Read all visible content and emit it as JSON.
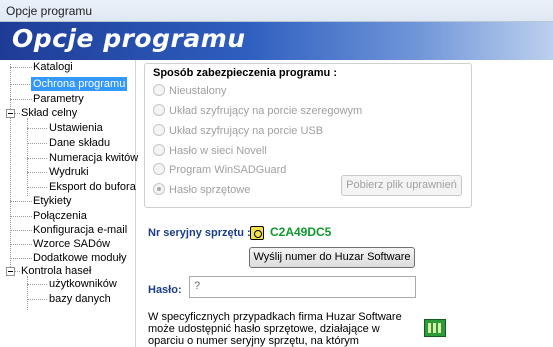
{
  "window": {
    "title": "Opcje programu"
  },
  "banner": {
    "title": "Opcje programu"
  },
  "tree": {
    "items": [
      "Katalogi",
      "Ochrona programu",
      "Parametry",
      "Skład celny",
      "Ustawienia",
      "Dane składu",
      "Numeracja kwitów",
      "Wydruki",
      "Eksport do bufora",
      "Etykiety",
      "Połączenia",
      "Konfiguracja e-mail",
      "Wzorce SADów",
      "Dodatkowe moduły",
      "Kontrola haseł",
      "użytkowników",
      "bazy danych"
    ],
    "selected": "Ochrona programu"
  },
  "protection": {
    "title": "Sposób zabezpieczenia programu :",
    "options": [
      "Nieustalony",
      "Układ szyfrujący na porcie szeregowym",
      "Układ szyfrujący na porcie USB",
      "Hasło w sieci Novell",
      "Program WinSADGuard",
      "Hasło sprzętowe"
    ],
    "selected": "Hasło sprzętowe",
    "download_button": "Pobierz plik uprawnień"
  },
  "serial": {
    "label": "Nr seryjny sprzętu :",
    "value": "C2A49DC5",
    "send_button": "Wyślij numer do Huzar Software"
  },
  "password": {
    "label": "Hasło:",
    "value": "?"
  },
  "info": {
    "text": "W specyficznych przypadkach firma Huzar Software może udostępnić hasło sprzętowe, działające w oparciu o numer seryjny sprzętu, na którym zainstalowano program"
  },
  "icons": {
    "key": "key-icon",
    "network": "network-card-icon"
  },
  "colors": {
    "selection": "#3399ff",
    "label_blue": "#1a3e8c",
    "serial_green": "#0e9a2e",
    "banner": "#1e3c96"
  }
}
